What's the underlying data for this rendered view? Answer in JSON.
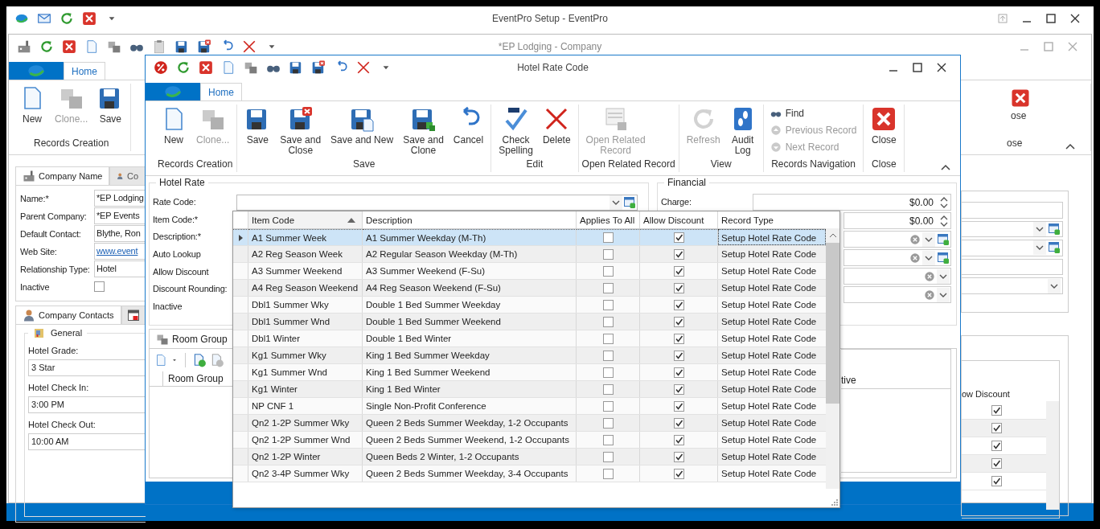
{
  "app_window": {
    "title": "EventPro Setup - EventPro"
  },
  "company_window": {
    "title": "*EP Lodging - Company",
    "ribbon_tab": "Home",
    "ribbon_group": "Records Creation",
    "ribbon_buttons": [
      {
        "label": "New",
        "disabled": false
      },
      {
        "label": "Clone...",
        "disabled": true
      },
      {
        "label": "Save",
        "disabled": false
      }
    ],
    "close_fragment": "ose",
    "close_group_fragment": "ose",
    "tabs": [
      {
        "label": "Company Name",
        "selected": true
      },
      {
        "label": "Co",
        "selected": false
      }
    ],
    "fields": [
      {
        "label": "Name:*",
        "kind": "text",
        "value": "*EP Lodging"
      },
      {
        "label": "Parent Company:",
        "kind": "text",
        "value": "*EP Events"
      },
      {
        "label": "Default Contact:",
        "kind": "text",
        "value": "Blythe, Ron"
      },
      {
        "label": "Web Site:",
        "kind": "link",
        "value": "www.event"
      },
      {
        "label": "Relationship Type:",
        "kind": "text",
        "value": "Hotel"
      },
      {
        "label": "Inactive",
        "kind": "checkbox",
        "checked": false
      }
    ],
    "contacts_tab": "Company Contacts",
    "general": {
      "title": "General",
      "fields": [
        {
          "label": "Hotel Grade:",
          "value": "3 Star"
        },
        {
          "label": "Hotel Check In:",
          "value": "3:00 PM"
        },
        {
          "label": "Hotel Check Out:",
          "value": "10:00 AM"
        }
      ]
    },
    "side_fields": [
      {
        "kind": "text"
      },
      {
        "kind": "lookup"
      },
      {
        "kind": "lookup"
      },
      {
        "kind": "text"
      },
      {
        "kind": "dropdown"
      }
    ],
    "side_grid": {
      "header_fragment": "ow Discount",
      "checks": [
        true,
        true,
        true,
        true,
        true
      ]
    }
  },
  "hotel_window": {
    "title": "Hotel Rate Code",
    "ribbon_tab": "Home",
    "ribbon_groups": [
      {
        "label": "Records Creation",
        "kind": "large",
        "buttons": [
          {
            "label": "New",
            "disabled": false
          },
          {
            "label": "Clone...",
            "disabled": true
          }
        ]
      },
      {
        "label": "Save",
        "kind": "large",
        "buttons": [
          {
            "label": "Save",
            "disabled": false
          },
          {
            "label": "Save and\nClose",
            "disabled": false
          },
          {
            "label": "Save and New",
            "disabled": false
          },
          {
            "label": "Save and\nClone",
            "disabled": false
          },
          {
            "label": "Cancel",
            "disabled": false
          }
        ]
      },
      {
        "label": "Edit",
        "kind": "large",
        "buttons": [
          {
            "label": "Check\nSpelling",
            "disabled": false
          },
          {
            "label": "Delete",
            "disabled": false
          }
        ]
      },
      {
        "label": "Open Related Record",
        "kind": "large",
        "buttons": [
          {
            "label": "Open Related\nRecord",
            "disabled": true
          }
        ]
      },
      {
        "label": "View",
        "kind": "large",
        "buttons": [
          {
            "label": "Refresh",
            "disabled": true
          },
          {
            "label": "Audit\nLog",
            "disabled": false
          }
        ]
      },
      {
        "label": "Records Navigation",
        "kind": "small",
        "buttons": [
          {
            "label": "Find",
            "disabled": false
          },
          {
            "label": "Previous Record",
            "disabled": true
          },
          {
            "label": "Next Record",
            "disabled": true
          }
        ]
      },
      {
        "label": "Close",
        "kind": "large",
        "buttons": [
          {
            "label": "Close",
            "disabled": false
          }
        ]
      }
    ],
    "hotel_rate": {
      "title": "Hotel Rate",
      "labels": [
        "Rate Code:",
        "Item Code:*",
        "Description:*",
        "Auto Lookup",
        "Allow Discount",
        "Discount Rounding:",
        "Inactive"
      ]
    },
    "financial": {
      "title": "Financial",
      "charge_label": "Charge:",
      "fields": [
        {
          "kind": "spin",
          "value": "$0.00"
        },
        {
          "kind": "spin",
          "value": "$0.00"
        },
        {
          "kind": "lookup"
        },
        {
          "kind": "lookup"
        },
        {
          "kind": "clearable"
        },
        {
          "kind": "clearable"
        }
      ]
    },
    "room_group": {
      "tab": "Room Group",
      "column": "Room Group"
    },
    "side_grid": {
      "header_fragment": "tive"
    }
  },
  "popup": {
    "columns": [
      {
        "label": "Item Code",
        "sorted": true
      },
      {
        "label": "Description",
        "sorted": false
      },
      {
        "label": "Applies To All",
        "sorted": false
      },
      {
        "label": "Allow Discount",
        "sorted": false
      },
      {
        "label": "Record Type",
        "sorted": false
      }
    ],
    "rows": [
      {
        "item_code": "A1 Summer Week",
        "description": "A1 Summer Weekday (M-Th)",
        "applies_to_all": false,
        "allow_discount": true,
        "record_type": "Setup Hotel Rate Code",
        "selected": true
      },
      {
        "item_code": "A2 Reg Season Week",
        "description": "A2 Regular Season Weekday (M-Th)",
        "applies_to_all": false,
        "allow_discount": true,
        "record_type": "Setup Hotel Rate Code",
        "selected": false
      },
      {
        "item_code": "A3 Summer Weekend",
        "description": "A3 Summer Weekend (F-Su)",
        "applies_to_all": false,
        "allow_discount": true,
        "record_type": "Setup Hotel Rate Code",
        "selected": false
      },
      {
        "item_code": "A4 Reg Season Weekend",
        "description": "A4 Reg Season Weekend (F-Su)",
        "applies_to_all": false,
        "allow_discount": true,
        "record_type": "Setup Hotel Rate Code",
        "selected": false
      },
      {
        "item_code": "Dbl1 Summer Wky",
        "description": "Double 1 Bed Summer Weekday",
        "applies_to_all": false,
        "allow_discount": true,
        "record_type": "Setup Hotel Rate Code",
        "selected": false
      },
      {
        "item_code": "Dbl1 Summer Wnd",
        "description": "Double 1 Bed Summer Weekend",
        "applies_to_all": false,
        "allow_discount": true,
        "record_type": "Setup Hotel Rate Code",
        "selected": false
      },
      {
        "item_code": "Dbl1 Winter",
        "description": "Double 1 Bed Winter",
        "applies_to_all": false,
        "allow_discount": true,
        "record_type": "Setup Hotel Rate Code",
        "selected": false
      },
      {
        "item_code": "Kg1 Summer Wky",
        "description": "King 1 Bed Summer Weekday",
        "applies_to_all": false,
        "allow_discount": true,
        "record_type": "Setup Hotel Rate Code",
        "selected": false
      },
      {
        "item_code": "Kg1 Summer Wnd",
        "description": "King 1 Bed Summer Weekend",
        "applies_to_all": false,
        "allow_discount": true,
        "record_type": "Setup Hotel Rate Code",
        "selected": false
      },
      {
        "item_code": "Kg1 Winter",
        "description": "King 1 Bed Winter",
        "applies_to_all": false,
        "allow_discount": true,
        "record_type": "Setup Hotel Rate Code",
        "selected": false
      },
      {
        "item_code": "NP CNF 1",
        "description": "Single Non-Profit Conference",
        "applies_to_all": false,
        "allow_discount": true,
        "record_type": "Setup Hotel Rate Code",
        "selected": false
      },
      {
        "item_code": "Qn2 1-2P Summer Wky",
        "description": "Queen 2 Beds Summer Weekday, 1-2 Occupants",
        "applies_to_all": false,
        "allow_discount": true,
        "record_type": "Setup Hotel Rate Code",
        "selected": false
      },
      {
        "item_code": "Qn2 1-2P Summer Wnd",
        "description": "Queen 2 Beds Summer Weekend, 1-2 Occupants",
        "applies_to_all": false,
        "allow_discount": true,
        "record_type": "Setup Hotel Rate Code",
        "selected": false
      },
      {
        "item_code": "Qn2 1-2P Winter",
        "description": "Queen Beds 2 Winter, 1-2 Occupants",
        "applies_to_all": false,
        "allow_discount": true,
        "record_type": "Setup Hotel Rate Code",
        "selected": false
      },
      {
        "item_code": "Qn2 3-4P Summer Wky",
        "description": "Queen 2 Beds Summer Weekday, 3-4 Occupants",
        "applies_to_all": false,
        "allow_discount": true,
        "record_type": "Setup Hotel Rate Code",
        "selected": false
      }
    ]
  }
}
